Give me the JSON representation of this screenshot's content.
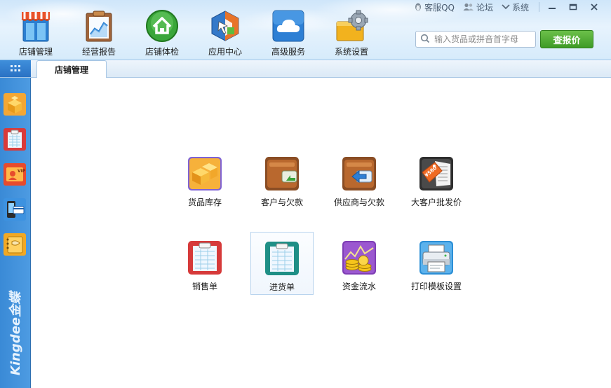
{
  "topbar": {
    "qq_label": "客服QQ",
    "forum_label": "论坛",
    "system_label": "系统"
  },
  "nav": {
    "items": [
      {
        "label": "店铺管理",
        "icon": "storefront-icon"
      },
      {
        "label": "经营报告",
        "icon": "report-chart-icon"
      },
      {
        "label": "店铺体检",
        "icon": "house-checkup-icon"
      },
      {
        "label": "应用中心",
        "icon": "app-center-icon"
      },
      {
        "label": "高级服务",
        "icon": "cloud-icon"
      },
      {
        "label": "系统设置",
        "icon": "settings-gear-icon"
      }
    ]
  },
  "search": {
    "placeholder": "输入货品或拼音首字母"
  },
  "price_button": "查报价",
  "tabs": [
    {
      "label": "店铺管理"
    }
  ],
  "sidebar": {
    "items": [
      {
        "icon": "boxes-icon"
      },
      {
        "icon": "sales-form-icon"
      },
      {
        "icon": "vip-card-icon"
      },
      {
        "icon": "phone-card-icon"
      },
      {
        "icon": "notebook-icon"
      }
    ],
    "brand": "Kingdee金蝶"
  },
  "tiles": [
    {
      "label": "货品库存",
      "icon": "inventory-boxes-icon"
    },
    {
      "label": "客户与欠款",
      "icon": "customer-wallet-icon"
    },
    {
      "label": "供应商与欠款",
      "icon": "supplier-wallet-icon"
    },
    {
      "label": "大客户批发价",
      "icon": "price-tag-icon"
    },
    {
      "label": "销售单",
      "icon": "sales-form-icon"
    },
    {
      "label": "进货单",
      "icon": "purchase-form-icon"
    },
    {
      "label": "资金流水",
      "icon": "money-coins-icon"
    },
    {
      "label": "打印模板设置",
      "icon": "printer-icon"
    }
  ],
  "colors": {
    "header_bg": "#d6ebfb",
    "sidebar_bg": "#3a8ad6",
    "price_button": "#4aa82f"
  }
}
